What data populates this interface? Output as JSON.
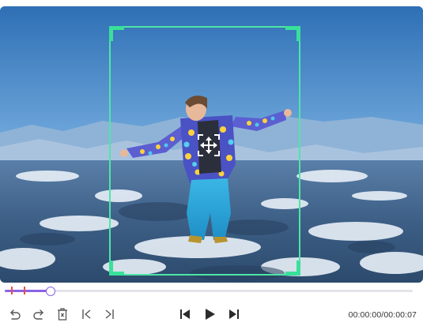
{
  "preview": {
    "image_description_icon": "photo-of-person-jumping-over-snowy-mountains",
    "crop_frame_color": "#4de6a6",
    "move_handle_icon": "move-arrows-icon"
  },
  "timeline": {
    "progress_fraction": 0.11,
    "accent_color": "#8a63e6",
    "marker_color": "#ef4b4b"
  },
  "controls": {
    "undo_icon": "undo-icon",
    "redo_icon": "redo-icon",
    "delete_icon": "delete-icon",
    "mark_in_icon": "mark-in-icon",
    "mark_out_icon": "mark-out-icon",
    "prev_icon": "skip-previous-icon",
    "play_icon": "play-icon",
    "next_icon": "skip-next-icon",
    "timecode": "00:00:00/00:00:07"
  }
}
